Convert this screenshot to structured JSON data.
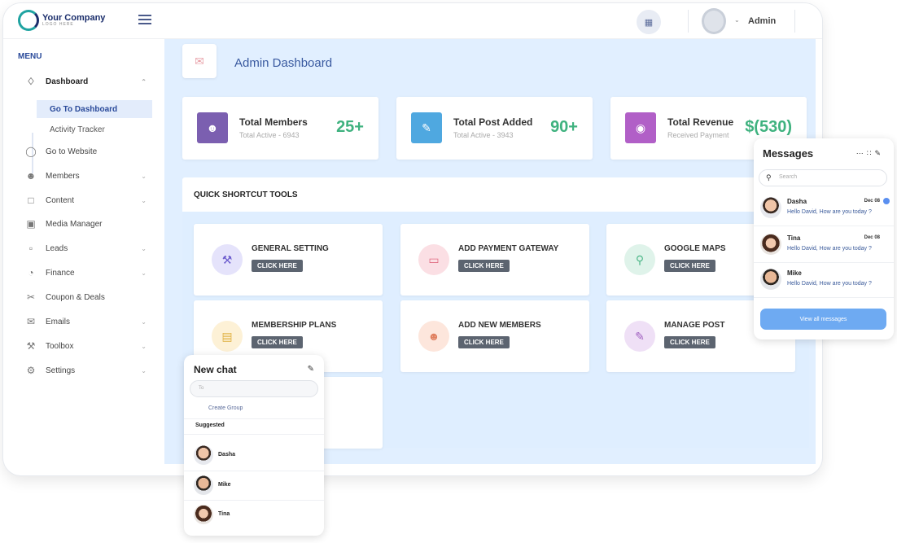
{
  "brand": {
    "name": "Your Company",
    "tagline": "LOGO HERE"
  },
  "topbar": {
    "user": "Admin",
    "apps_icon": "grid-icon"
  },
  "sidebar": {
    "menu_title": "MENU",
    "dashboard": "Dashboard",
    "sub_items": [
      "Go To Dashboard",
      "Activity Tracker"
    ],
    "items": [
      {
        "label": "Go to Website",
        "icon": "globe-icon"
      },
      {
        "label": "Members",
        "icon": "users-icon"
      },
      {
        "label": "Content",
        "icon": "file-icon"
      },
      {
        "label": "Media Manager",
        "icon": "image-icon"
      },
      {
        "label": "Leads",
        "icon": "folder-icon"
      },
      {
        "label": "Finance",
        "icon": "chart-icon"
      },
      {
        "label": "Coupon & Deals",
        "icon": "ticket-icon"
      },
      {
        "label": "Emails",
        "icon": "mail-icon"
      },
      {
        "label": "Toolbox",
        "icon": "tools-icon"
      },
      {
        "label": "Settings",
        "icon": "gear-icon"
      }
    ]
  },
  "main": {
    "title": "Admin Dashboard",
    "stats": [
      {
        "title": "Total Members",
        "sub": "Total Active - 6943",
        "value": "25+",
        "color": "#7b5fb0"
      },
      {
        "title": "Total Post Added",
        "sub": "Total Active - 3943",
        "value": "90+",
        "color": "#4fa8e0"
      },
      {
        "title": "Total Revenue",
        "sub": "Received Payment",
        "value": "$(530)",
        "color": "#b15fc7"
      }
    ],
    "tools_title": "QUICK SHORTCUT TOOLS",
    "tools": [
      {
        "name": "GENERAL SETTING",
        "btn": "CLICK HERE",
        "bg": "#e5e3fb",
        "fg": "#6a5acd"
      },
      {
        "name": "ADD PAYMENT GATEWAY",
        "btn": "CLICK HERE",
        "bg": "#fbdfe4",
        "fg": "#e06b80"
      },
      {
        "name": "GOOGLE MAPS",
        "btn": "CLICK HERE",
        "bg": "#dff3ea",
        "fg": "#4fb88a"
      },
      {
        "name": "MEMBERSHIP PLANS",
        "btn": "CLICK HERE",
        "bg": "#fdf1d6",
        "fg": "#e0b040"
      },
      {
        "name": "ADD NEW MEMBERS",
        "btn": "CLICK HERE",
        "bg": "#fde6dc",
        "fg": "#e08060"
      },
      {
        "name": "MANAGE POST",
        "btn": "CLICK HERE",
        "bg": "#efe0f6",
        "fg": "#a060c0"
      }
    ]
  },
  "messages": {
    "title": "Messages",
    "search_placeholder": "Search",
    "items": [
      {
        "name": "Dasha",
        "date": "Dec 08",
        "text": "Hello David, How are you today ?"
      },
      {
        "name": "Tina",
        "date": "Dec 08",
        "text": "Hello David, How are you today ?"
      },
      {
        "name": "Mike",
        "date": "",
        "text": "Hello David, How are you today ?"
      }
    ],
    "view_all": "View all messages"
  },
  "new_chat": {
    "title": "New chat",
    "to_placeholder": "To",
    "create_group": "Create Group",
    "suggested": "Suggested",
    "contacts": [
      "Dasha",
      "Mike",
      "Tina"
    ]
  }
}
